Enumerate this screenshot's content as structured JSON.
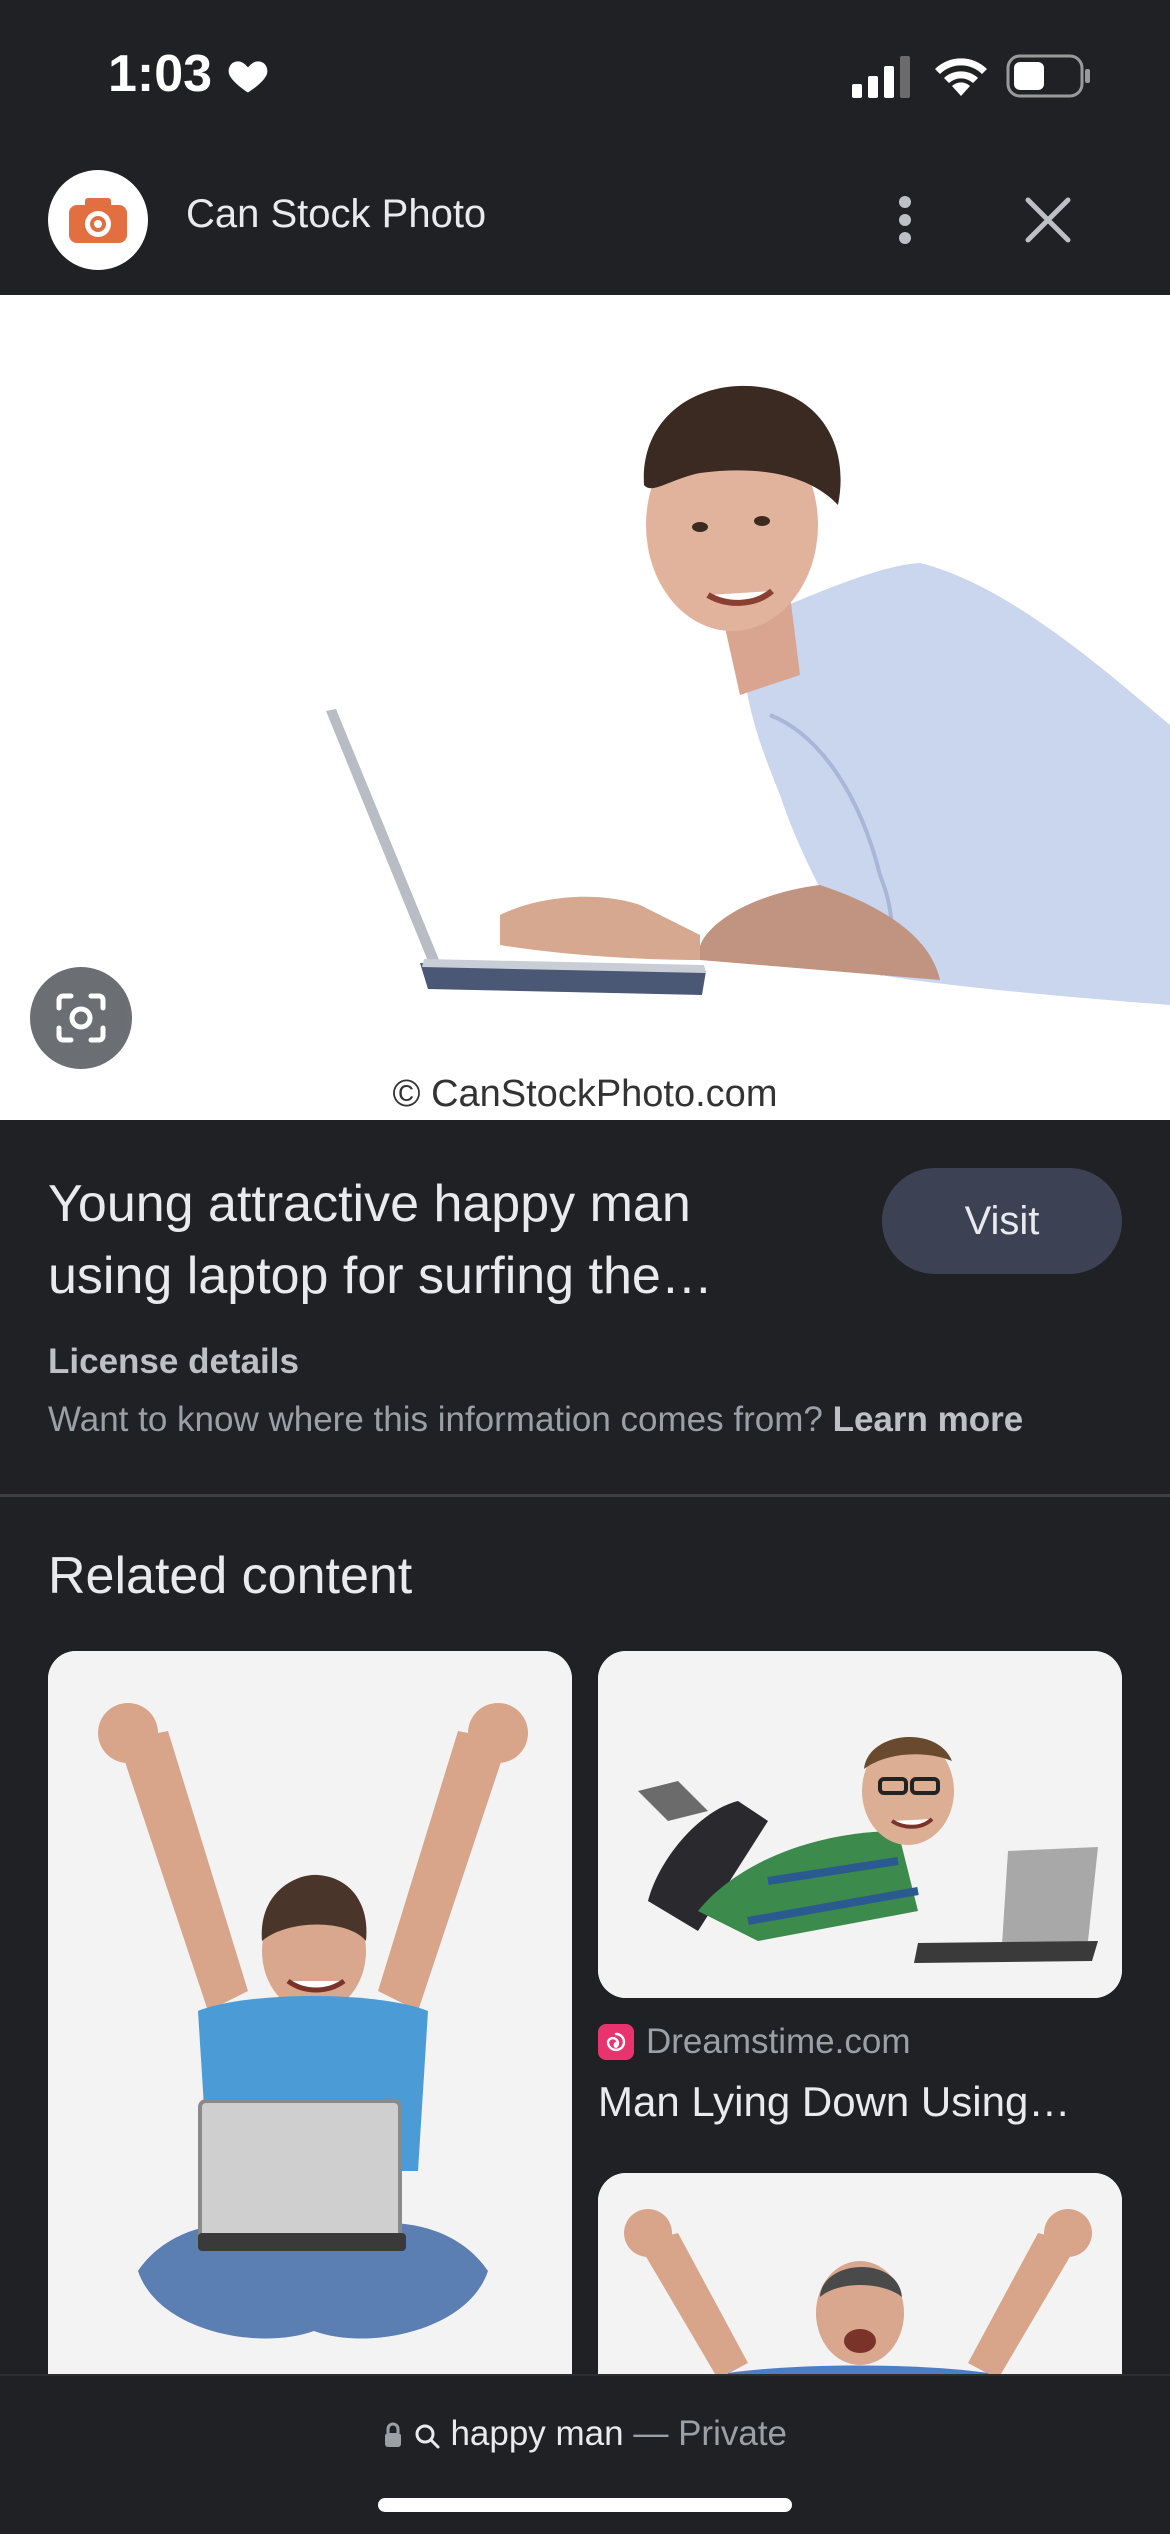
{
  "status_bar": {
    "time": "1:03"
  },
  "header": {
    "site_name": "Can Stock Photo"
  },
  "hero": {
    "watermark": "© CanStockPhoto.com"
  },
  "info": {
    "title": "Young attractive happy man using laptop for surfing the…",
    "visit_label": "Visit",
    "license_label": "License details",
    "source_question": "Want to know where this information comes from?",
    "learn_more": "Learn more"
  },
  "related": {
    "heading": "Related content",
    "items": [
      {
        "source": "Dreamstime.com",
        "caption": "Man Lying Down Using…"
      }
    ]
  },
  "address_bar": {
    "query": "happy man",
    "separator": "—",
    "mode": "Private"
  },
  "colors": {
    "background": "#202124",
    "visit_button": "#3c4253",
    "accent_orange": "#e26f3f",
    "dreamstime_pink": "#e8336e"
  }
}
